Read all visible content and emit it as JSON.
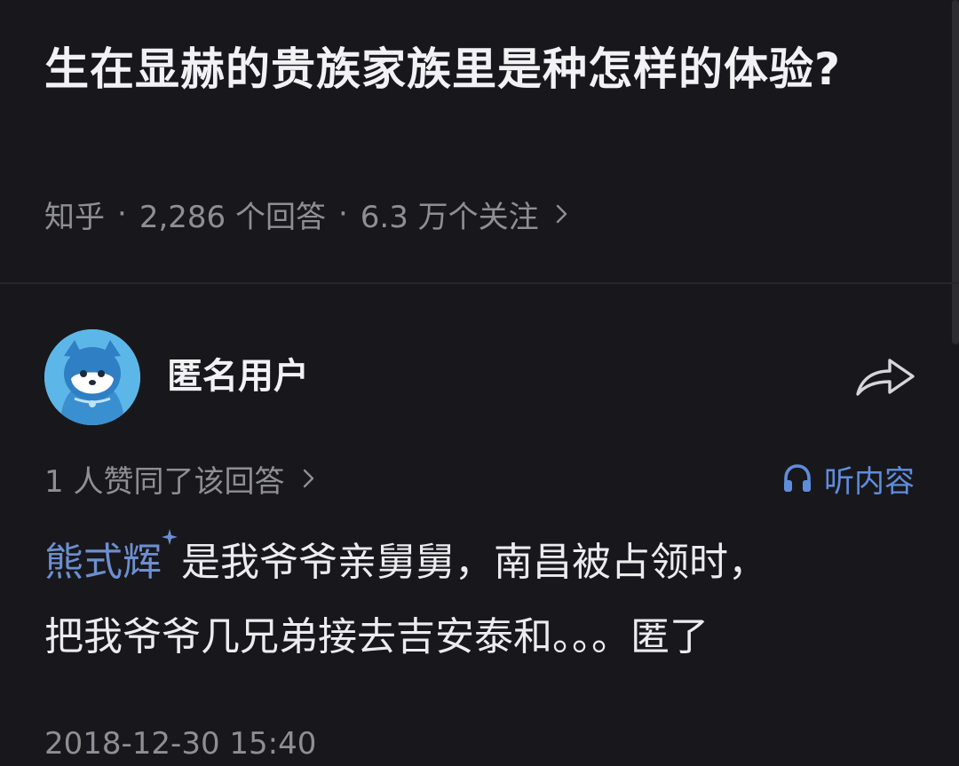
{
  "question": {
    "title": "生在显赫的贵族家族里是种怎样的体验?",
    "meta": {
      "source": "知乎",
      "answers": "2,286 个回答",
      "followers": "6.3 万个关注",
      "separator": "·"
    }
  },
  "answer": {
    "author": {
      "name": "匿名用户",
      "avatar_icon": "anonymous-avatar-icon"
    },
    "share_icon": "share-arrow-icon",
    "votes_text": "1 人赞同了该回答",
    "listen": {
      "label": "听内容",
      "icon": "headphones-icon"
    },
    "content": {
      "link_text": "熊式辉",
      "line1_rest": "是我爷爷亲舅舅，南昌被占领时，",
      "line2": "把我爷爷几兄弟接去吉安泰和。。。匿了"
    },
    "timestamp": "2018-12-30 15:40"
  },
  "colors": {
    "background": "#18181c",
    "text_primary": "#f2f2f4",
    "text_secondary": "#8e8e95",
    "accent_blue": "#5f8ddb",
    "link_blue": "#6d8fd0",
    "avatar_bg": "#5cb7e8"
  }
}
